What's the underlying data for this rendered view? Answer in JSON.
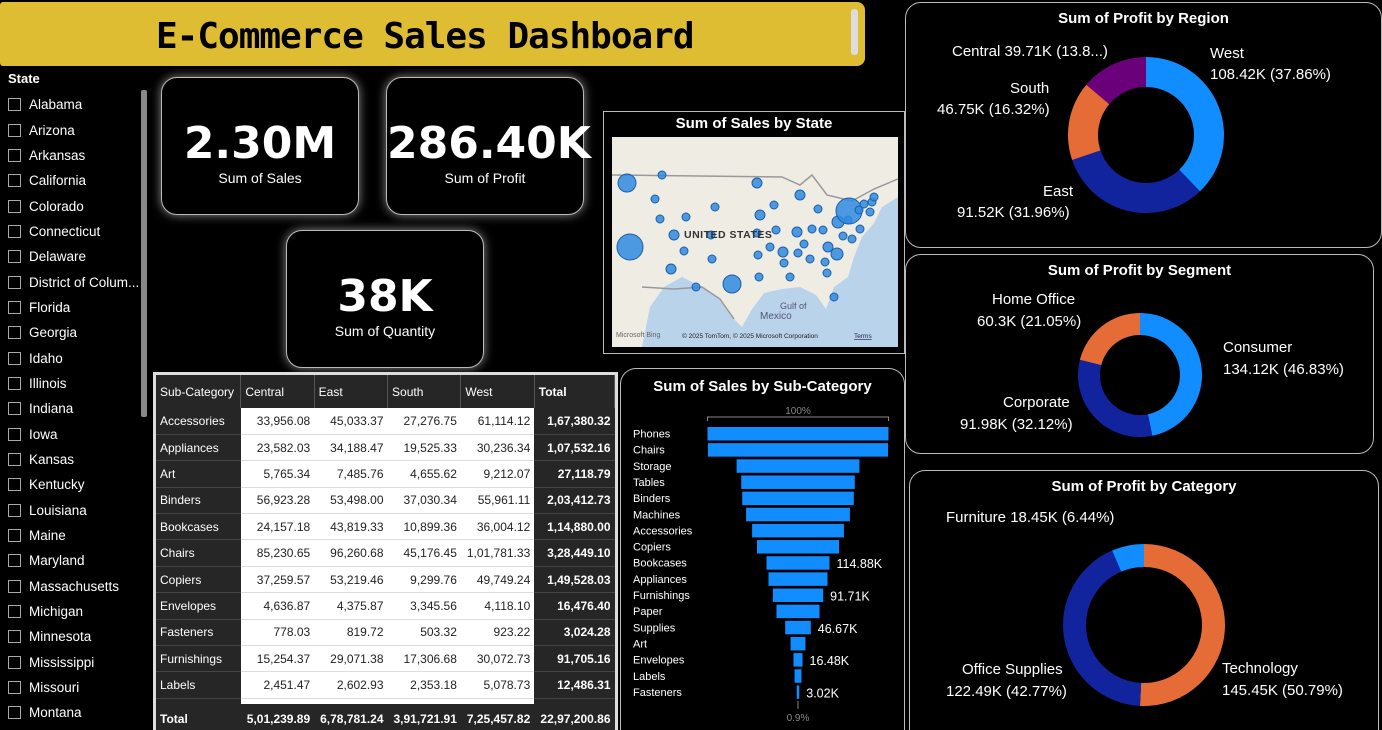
{
  "header": {
    "title": "E-Commerce Sales Dashboard"
  },
  "slicer": {
    "title": "State",
    "items": [
      "Alabama",
      "Arizona",
      "Arkansas",
      "California",
      "Colorado",
      "Connecticut",
      "Delaware",
      "District of Colum...",
      "Florida",
      "Georgia",
      "Idaho",
      "Illinois",
      "Indiana",
      "Iowa",
      "Kansas",
      "Kentucky",
      "Louisiana",
      "Maine",
      "Maryland",
      "Massachusetts",
      "Michigan",
      "Minnesota",
      "Mississippi",
      "Missouri",
      "Montana"
    ]
  },
  "kpis": {
    "sales": {
      "value": "2.30M",
      "label": "Sum of Sales"
    },
    "profit": {
      "value": "286.40K",
      "label": "Sum of Profit"
    },
    "quantity": {
      "value": "38K",
      "label": "Sum of Quantity"
    }
  },
  "map": {
    "title": "Sum of Sales by State",
    "country_label": "UNITED STATES",
    "gulf_label": "Gulf of\nMexico",
    "mexico_label": "Mexico",
    "bing_label": "Microsoft Bing",
    "copyright": "© 2025 TomTom, © 2025 Microsoft Corporation",
    "terms": "Terms",
    "colors": {
      "water": "#b9d3ea",
      "land": "#efece4",
      "bubble": "#2f8be0"
    }
  },
  "table": {
    "columns": [
      "Sub-Category",
      "Central",
      "East",
      "South",
      "West",
      "Total"
    ],
    "rows": [
      [
        "Accessories",
        "33,956.08",
        "45,033.37",
        "27,276.75",
        "61,114.12",
        "1,67,380.32"
      ],
      [
        "Appliances",
        "23,582.03",
        "34,188.47",
        "19,525.33",
        "30,236.34",
        "1,07,532.16"
      ],
      [
        "Art",
        "5,765.34",
        "7,485.76",
        "4,655.62",
        "9,212.07",
        "27,118.79"
      ],
      [
        "Binders",
        "56,923.28",
        "53,498.00",
        "37,030.34",
        "55,961.11",
        "2,03,412.73"
      ],
      [
        "Bookcases",
        "24,157.18",
        "43,819.33",
        "10,899.36",
        "36,004.12",
        "1,14,880.00"
      ],
      [
        "Chairs",
        "85,230.65",
        "96,260.68",
        "45,176.45",
        "1,01,781.33",
        "3,28,449.10"
      ],
      [
        "Copiers",
        "37,259.57",
        "53,219.46",
        "9,299.76",
        "49,749.24",
        "1,49,528.03"
      ],
      [
        "Envelopes",
        "4,636.87",
        "4,375.87",
        "3,345.56",
        "4,118.10",
        "16,476.40"
      ],
      [
        "Fasteners",
        "778.03",
        "819.72",
        "503.32",
        "923.22",
        "3,024.28"
      ],
      [
        "Furnishings",
        "15,254.37",
        "29,071.38",
        "17,306.68",
        "30,072.73",
        "91,705.16"
      ],
      [
        "Labels",
        "2,451.47",
        "2,602.93",
        "2,353.18",
        "5,078.73",
        "12,486.31"
      ]
    ],
    "total": [
      "Total",
      "5,01,239.89",
      "6,78,781.24",
      "3,91,721.91",
      "7,25,457.82",
      "22,97,200.86"
    ]
  },
  "chart_data": [
    {
      "type": "pie",
      "title": "Sum of Profit by Region",
      "categories": [
        "West",
        "East",
        "South",
        "Central"
      ],
      "values": [
        108.42,
        91.52,
        46.75,
        39.71
      ],
      "value_labels": [
        "108.42K (37.86%)",
        "91.52K (31.96%)",
        "46.75K (16.32%)",
        "Central 39.71K (13.8...)"
      ],
      "colors": [
        "#118dff",
        "#12239e",
        "#e66c37",
        "#6b007b"
      ],
      "unit": "K"
    },
    {
      "type": "pie",
      "title": "Sum of Profit by Segment",
      "categories": [
        "Consumer",
        "Corporate",
        "Home Office"
      ],
      "values": [
        134.12,
        91.98,
        60.3
      ],
      "value_labels": [
        "134.12K (46.83%)",
        "91.98K (32.12%)",
        "60.3K (21.05%)"
      ],
      "colors": [
        "#118dff",
        "#12239e",
        "#e66c37"
      ],
      "unit": "K"
    },
    {
      "type": "pie",
      "title": "Sum of Profit by Category",
      "categories": [
        "Technology",
        "Office Supplies",
        "Furniture"
      ],
      "values": [
        145.45,
        122.49,
        18.45
      ],
      "value_labels": [
        "145.45K (50.79%)",
        "122.49K (42.77%)",
        "Furniture 18.45K (6.44%)"
      ],
      "colors": [
        "#e66c37",
        "#12239e",
        "#118dff"
      ],
      "unit": "K"
    },
    {
      "type": "bar",
      "subtype": "funnel",
      "title": "Sum of Sales by Sub-Category",
      "categories": [
        "Phones",
        "Chairs",
        "Storage",
        "Tables",
        "Binders",
        "Machines",
        "Accessories",
        "Copiers",
        "Bookcases",
        "Appliances",
        "Furnishings",
        "Paper",
        "Supplies",
        "Art",
        "Envelopes",
        "Labels",
        "Fasteners"
      ],
      "values": [
        330.01,
        328.45,
        223.84,
        206.97,
        203.41,
        189.24,
        167.38,
        149.53,
        114.88,
        107.53,
        91.71,
        78.48,
        46.67,
        27.12,
        16.48,
        12.49,
        3.02
      ],
      "data_labels": [
        "",
        "",
        "",
        "",
        "",
        "",
        "",
        "",
        "114.88K",
        "",
        "91.71K",
        "",
        "46.67K",
        "",
        "16.48K",
        "",
        "3.02K"
      ],
      "top_label": "100%",
      "bottom_label": "0.9%",
      "unit": "K",
      "color": "#118dff"
    }
  ]
}
